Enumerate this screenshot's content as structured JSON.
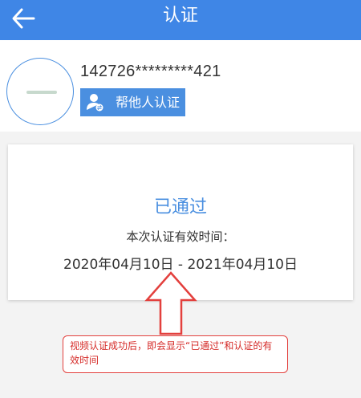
{
  "header": {
    "title": "认证",
    "back_icon": "arrow-left-icon",
    "background": "#3f86e6"
  },
  "profile": {
    "id_number": "142726*********421",
    "help_button": {
      "label": "帮他人认证",
      "icon": "user-swap-icon"
    }
  },
  "status_card": {
    "status": "已通过",
    "validity_label": "本次认证有效时间：",
    "validity_range": "2020年04月10日 - 2021年04月10日"
  },
  "annotation": {
    "note": "视频认证成功后，即会显示“已通过”和认证的有效时间",
    "color": "#e3403d"
  },
  "colors": {
    "accent": "#4a8fe0",
    "page_bg": "#f3f3f3"
  }
}
